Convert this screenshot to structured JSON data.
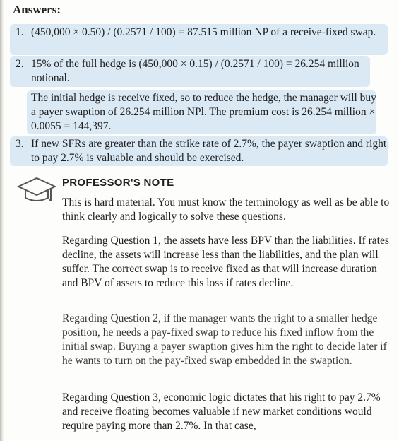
{
  "answers_title": "Answers:",
  "answers": [
    {
      "num": "1.",
      "text": "(450,000 × 0.50) / (0.2571 / 100) = 87.515 million NP of a receive-fixed swap."
    },
    {
      "num": "2.",
      "text": "15% of the full hedge is (450,000 × 0.15) / (0.2571 / 100) = 26.254 million notional."
    },
    {
      "num": "",
      "text": "The initial hedge is receive fixed, so to reduce the hedge, the manager will buy a payer swaption of 26.254 million NPl. The premium cost is 26.254 million × 0.0055 = 144,397."
    },
    {
      "num": "3.",
      "text": "If new SFRs are greater than the strike rate of 2.7%, the payer swaption and right to pay 2.7% is valuable and should be exercised."
    }
  ],
  "professor_note": {
    "title": "PROFESSOR'S NOTE",
    "icon": "graduation-cap-icon",
    "paragraphs": [
      "This is hard material. You must know the terminology as well as be able to think clearly and logically to solve these questions.",
      "Regarding Question 1, the assets have less BPV than the liabilities. If rates decline, the assets will increase less than the liabilities, and the plan will suffer. The correct swap is to receive fixed as that will increase duration and BPV of assets to reduce this loss if rates decline.",
      "Regarding Question 2, if the manager wants the right to a smaller hedge position, he needs a pay-fixed swap to reduce his fixed inflow from the initial swap. Buying a payer swaption gives him the right to decide later if he wants to turn on the pay-fixed swap embedded in the swaption.",
      "Regarding Question 3, economic logic dictates that his right to pay 2.7% and receive floating becomes valuable if new market conditions would require paying more than 2.7%. In that case,"
    ]
  },
  "colors": {
    "highlight": "#dbe9f4",
    "text": "#1f1f1f"
  }
}
